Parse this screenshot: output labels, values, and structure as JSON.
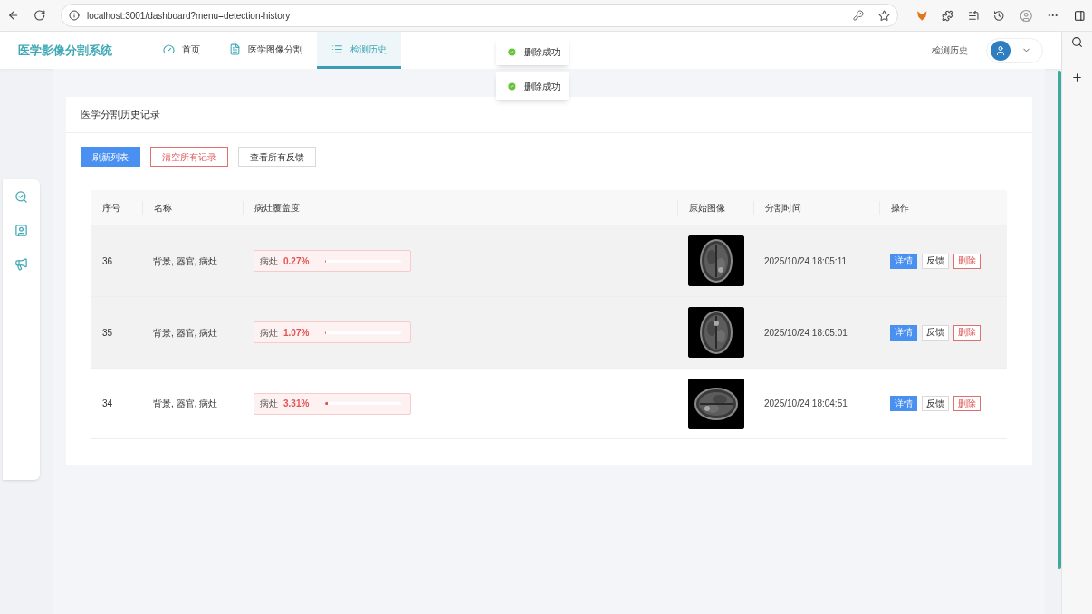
{
  "browser": {
    "url": "localhost:3001/dashboard?menu=detection-history"
  },
  "header": {
    "logo": "医学影像分割系统",
    "nav": [
      {
        "label": "首页",
        "selected": false
      },
      {
        "label": "医学图像分割",
        "selected": false
      },
      {
        "label": "检测历史",
        "selected": true
      }
    ],
    "current_page": "检测历史"
  },
  "toasts": [
    "删除成功",
    "删除成功"
  ],
  "card": {
    "title": "医学分割历史记录",
    "buttons": [
      {
        "label": "刷新列表",
        "kind": "primary"
      },
      {
        "label": "清空所有记录",
        "kind": "danger"
      },
      {
        "label": "查看所有反馈",
        "kind": "default"
      }
    ],
    "table": {
      "columns": [
        "序号",
        "名称",
        "病灶覆盖度",
        "原始图像",
        "分割时间",
        "操作"
      ],
      "rows": [
        {
          "id": "36",
          "name": "背景, 器官, 病灶",
          "tag": "病灶",
          "percent": "0.27%",
          "level": 0.0027,
          "time": "2025/10/24 18:05:11",
          "highlighted": true,
          "actions": [
            "详情",
            "反馈",
            "删除"
          ]
        },
        {
          "id": "35",
          "name": "背景, 器官, 病灶",
          "tag": "病灶",
          "percent": "1.07%",
          "level": 0.0107,
          "time": "2025/10/24 18:05:01",
          "highlighted": true,
          "actions": [
            "详情",
            "反馈",
            "删除"
          ]
        },
        {
          "id": "34",
          "name": "背景, 器官, 病灶",
          "tag": "病灶",
          "percent": "3.31%",
          "level": 0.0331,
          "time": "2025/10/24 18:04:51",
          "highlighted": false,
          "actions": [
            "详情",
            "反馈",
            "删除"
          ]
        }
      ]
    }
  }
}
